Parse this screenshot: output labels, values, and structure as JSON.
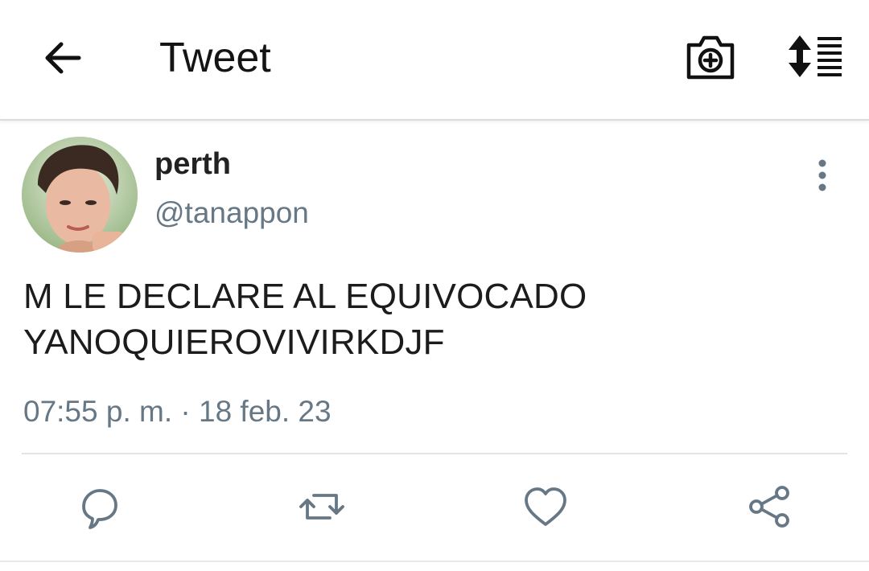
{
  "header": {
    "title": "Tweet"
  },
  "tweet": {
    "author_name": "perth",
    "author_handle": "@tanappon",
    "text": "M LE DECLARE AL EQUIVOCADO\nYANOQUIEROVIVIRKDJF",
    "time": "07:55 p. m. · 18 feb. 23"
  },
  "icons": {
    "back": "arrow-left-icon",
    "camera": "camera-add-icon",
    "sort": "sort-list-icon",
    "more": "more-vertical-icon",
    "reply": "reply-icon",
    "retweet": "retweet-icon",
    "like": "heart-icon",
    "share": "share-icon"
  },
  "colors": {
    "icon_gray": "#667785",
    "text": "#14171a"
  }
}
